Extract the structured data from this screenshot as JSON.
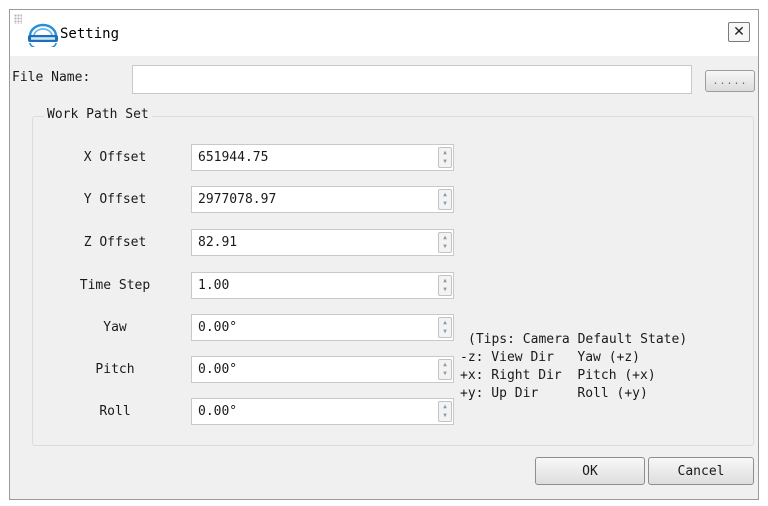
{
  "window": {
    "title": "Setting",
    "close_icon": "close-icon"
  },
  "file": {
    "label": "File Name:",
    "value": "",
    "browse_label": "....."
  },
  "work_path": {
    "group_title": "Work Path Set",
    "fields": [
      {
        "label": "X Offset",
        "value": "651944.75"
      },
      {
        "label": "Y Offset",
        "value": "2977078.97"
      },
      {
        "label": "Z Offset",
        "value": "82.91"
      },
      {
        "label": "Time Step",
        "value": "1.00"
      },
      {
        "label": "Yaw",
        "value": "0.00°"
      },
      {
        "label": "Pitch",
        "value": "0.00°"
      },
      {
        "label": "Roll",
        "value": "0.00°"
      }
    ]
  },
  "tips": {
    "heading": "(Tips: Camera Default State)",
    "lines": [
      "-z: View Dir   Yaw (+z)",
      "+x: Right Dir  Pitch (+x)",
      "+y: Up Dir     Roll (+y)"
    ]
  },
  "buttons": {
    "ok": "OK",
    "cancel": "Cancel"
  },
  "colors": {
    "dialog_bg": "#f0f0f0",
    "border": "#9a9a9a"
  }
}
